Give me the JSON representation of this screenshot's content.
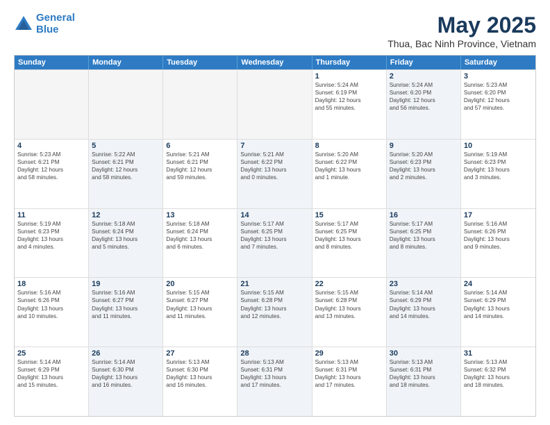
{
  "header": {
    "logo_line1": "General",
    "logo_line2": "Blue",
    "title": "May 2025",
    "subtitle": "Thua, Bac Ninh Province, Vietnam"
  },
  "weekdays": [
    "Sunday",
    "Monday",
    "Tuesday",
    "Wednesday",
    "Thursday",
    "Friday",
    "Saturday"
  ],
  "rows": [
    [
      {
        "day": "",
        "lines": [],
        "shaded": false,
        "empty": true
      },
      {
        "day": "",
        "lines": [],
        "shaded": false,
        "empty": true
      },
      {
        "day": "",
        "lines": [],
        "shaded": false,
        "empty": true
      },
      {
        "day": "",
        "lines": [],
        "shaded": false,
        "empty": true
      },
      {
        "day": "1",
        "lines": [
          "Sunrise: 5:24 AM",
          "Sunset: 6:19 PM",
          "Daylight: 12 hours",
          "and 55 minutes."
        ],
        "shaded": false,
        "empty": false
      },
      {
        "day": "2",
        "lines": [
          "Sunrise: 5:24 AM",
          "Sunset: 6:20 PM",
          "Daylight: 12 hours",
          "and 56 minutes."
        ],
        "shaded": true,
        "empty": false
      },
      {
        "day": "3",
        "lines": [
          "Sunrise: 5:23 AM",
          "Sunset: 6:20 PM",
          "Daylight: 12 hours",
          "and 57 minutes."
        ],
        "shaded": false,
        "empty": false
      }
    ],
    [
      {
        "day": "4",
        "lines": [
          "Sunrise: 5:23 AM",
          "Sunset: 6:21 PM",
          "Daylight: 12 hours",
          "and 58 minutes."
        ],
        "shaded": false,
        "empty": false
      },
      {
        "day": "5",
        "lines": [
          "Sunrise: 5:22 AM",
          "Sunset: 6:21 PM",
          "Daylight: 12 hours",
          "and 58 minutes."
        ],
        "shaded": true,
        "empty": false
      },
      {
        "day": "6",
        "lines": [
          "Sunrise: 5:21 AM",
          "Sunset: 6:21 PM",
          "Daylight: 12 hours",
          "and 59 minutes."
        ],
        "shaded": false,
        "empty": false
      },
      {
        "day": "7",
        "lines": [
          "Sunrise: 5:21 AM",
          "Sunset: 6:22 PM",
          "Daylight: 13 hours",
          "and 0 minutes."
        ],
        "shaded": true,
        "empty": false
      },
      {
        "day": "8",
        "lines": [
          "Sunrise: 5:20 AM",
          "Sunset: 6:22 PM",
          "Daylight: 13 hours",
          "and 1 minute."
        ],
        "shaded": false,
        "empty": false
      },
      {
        "day": "9",
        "lines": [
          "Sunrise: 5:20 AM",
          "Sunset: 6:23 PM",
          "Daylight: 13 hours",
          "and 2 minutes."
        ],
        "shaded": true,
        "empty": false
      },
      {
        "day": "10",
        "lines": [
          "Sunrise: 5:19 AM",
          "Sunset: 6:23 PM",
          "Daylight: 13 hours",
          "and 3 minutes."
        ],
        "shaded": false,
        "empty": false
      }
    ],
    [
      {
        "day": "11",
        "lines": [
          "Sunrise: 5:19 AM",
          "Sunset: 6:23 PM",
          "Daylight: 13 hours",
          "and 4 minutes."
        ],
        "shaded": false,
        "empty": false
      },
      {
        "day": "12",
        "lines": [
          "Sunrise: 5:18 AM",
          "Sunset: 6:24 PM",
          "Daylight: 13 hours",
          "and 5 minutes."
        ],
        "shaded": true,
        "empty": false
      },
      {
        "day": "13",
        "lines": [
          "Sunrise: 5:18 AM",
          "Sunset: 6:24 PM",
          "Daylight: 13 hours",
          "and 6 minutes."
        ],
        "shaded": false,
        "empty": false
      },
      {
        "day": "14",
        "lines": [
          "Sunrise: 5:17 AM",
          "Sunset: 6:25 PM",
          "Daylight: 13 hours",
          "and 7 minutes."
        ],
        "shaded": true,
        "empty": false
      },
      {
        "day": "15",
        "lines": [
          "Sunrise: 5:17 AM",
          "Sunset: 6:25 PM",
          "Daylight: 13 hours",
          "and 8 minutes."
        ],
        "shaded": false,
        "empty": false
      },
      {
        "day": "16",
        "lines": [
          "Sunrise: 5:17 AM",
          "Sunset: 6:25 PM",
          "Daylight: 13 hours",
          "and 8 minutes."
        ],
        "shaded": true,
        "empty": false
      },
      {
        "day": "17",
        "lines": [
          "Sunrise: 5:16 AM",
          "Sunset: 6:26 PM",
          "Daylight: 13 hours",
          "and 9 minutes."
        ],
        "shaded": false,
        "empty": false
      }
    ],
    [
      {
        "day": "18",
        "lines": [
          "Sunrise: 5:16 AM",
          "Sunset: 6:26 PM",
          "Daylight: 13 hours",
          "and 10 minutes."
        ],
        "shaded": false,
        "empty": false
      },
      {
        "day": "19",
        "lines": [
          "Sunrise: 5:16 AM",
          "Sunset: 6:27 PM",
          "Daylight: 13 hours",
          "and 11 minutes."
        ],
        "shaded": true,
        "empty": false
      },
      {
        "day": "20",
        "lines": [
          "Sunrise: 5:15 AM",
          "Sunset: 6:27 PM",
          "Daylight: 13 hours",
          "and 11 minutes."
        ],
        "shaded": false,
        "empty": false
      },
      {
        "day": "21",
        "lines": [
          "Sunrise: 5:15 AM",
          "Sunset: 6:28 PM",
          "Daylight: 13 hours",
          "and 12 minutes."
        ],
        "shaded": true,
        "empty": false
      },
      {
        "day": "22",
        "lines": [
          "Sunrise: 5:15 AM",
          "Sunset: 6:28 PM",
          "Daylight: 13 hours",
          "and 13 minutes."
        ],
        "shaded": false,
        "empty": false
      },
      {
        "day": "23",
        "lines": [
          "Sunrise: 5:14 AM",
          "Sunset: 6:29 PM",
          "Daylight: 13 hours",
          "and 14 minutes."
        ],
        "shaded": true,
        "empty": false
      },
      {
        "day": "24",
        "lines": [
          "Sunrise: 5:14 AM",
          "Sunset: 6:29 PM",
          "Daylight: 13 hours",
          "and 14 minutes."
        ],
        "shaded": false,
        "empty": false
      }
    ],
    [
      {
        "day": "25",
        "lines": [
          "Sunrise: 5:14 AM",
          "Sunset: 6:29 PM",
          "Daylight: 13 hours",
          "and 15 minutes."
        ],
        "shaded": false,
        "empty": false
      },
      {
        "day": "26",
        "lines": [
          "Sunrise: 5:14 AM",
          "Sunset: 6:30 PM",
          "Daylight: 13 hours",
          "and 16 minutes."
        ],
        "shaded": true,
        "empty": false
      },
      {
        "day": "27",
        "lines": [
          "Sunrise: 5:13 AM",
          "Sunset: 6:30 PM",
          "Daylight: 13 hours",
          "and 16 minutes."
        ],
        "shaded": false,
        "empty": false
      },
      {
        "day": "28",
        "lines": [
          "Sunrise: 5:13 AM",
          "Sunset: 6:31 PM",
          "Daylight: 13 hours",
          "and 17 minutes."
        ],
        "shaded": true,
        "empty": false
      },
      {
        "day": "29",
        "lines": [
          "Sunrise: 5:13 AM",
          "Sunset: 6:31 PM",
          "Daylight: 13 hours",
          "and 17 minutes."
        ],
        "shaded": false,
        "empty": false
      },
      {
        "day": "30",
        "lines": [
          "Sunrise: 5:13 AM",
          "Sunset: 6:31 PM",
          "Daylight: 13 hours",
          "and 18 minutes."
        ],
        "shaded": true,
        "empty": false
      },
      {
        "day": "31",
        "lines": [
          "Sunrise: 5:13 AM",
          "Sunset: 6:32 PM",
          "Daylight: 13 hours",
          "and 18 minutes."
        ],
        "shaded": false,
        "empty": false
      }
    ]
  ]
}
